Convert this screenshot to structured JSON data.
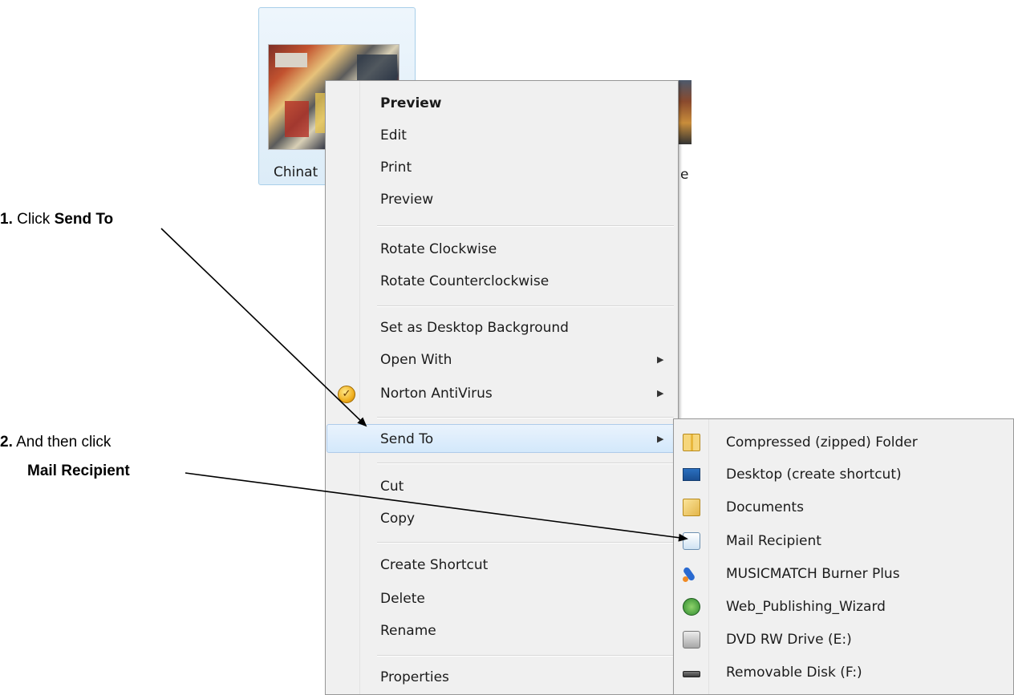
{
  "instructions": {
    "step1": {
      "num": "1.",
      "text": "Click ",
      "bold": "Send To"
    },
    "step2": {
      "num": "2.",
      "text": "And then click",
      "bold": "Mail Recipient"
    }
  },
  "files": [
    {
      "label": "Chinat",
      "icon": "photo-thumbnail-icon"
    },
    {
      "label": "e",
      "icon": "photo-thumbnail-icon"
    }
  ],
  "context_menu": {
    "items": [
      {
        "label": "Preview",
        "bold": true
      },
      {
        "label": "Edit"
      },
      {
        "label": "Print"
      },
      {
        "label": "Preview"
      },
      {
        "label": "Rotate Clockwise"
      },
      {
        "label": "Rotate Counterclockwise"
      },
      {
        "label": "Set as Desktop Background"
      },
      {
        "label": "Open With",
        "submenu": true
      },
      {
        "label": "Norton AntiVirus",
        "submenu": true,
        "icon": "norton-icon"
      },
      {
        "label": "Send To",
        "submenu": true,
        "highlighted": true
      },
      {
        "label": "Cut"
      },
      {
        "label": "Copy"
      },
      {
        "label": "Create Shortcut"
      },
      {
        "label": "Delete"
      },
      {
        "label": "Rename"
      },
      {
        "label": "Properties"
      }
    ],
    "arrow_glyph": "▶"
  },
  "send_to_menu": {
    "items": [
      {
        "label": "Compressed (zipped) Folder",
        "icon": "zip-folder-icon"
      },
      {
        "label": "Desktop (create shortcut)",
        "icon": "desktop-icon"
      },
      {
        "label": "Documents",
        "icon": "documents-folder-icon"
      },
      {
        "label": "Mail Recipient",
        "icon": "mail-icon"
      },
      {
        "label": "MUSICMATCH Burner Plus",
        "icon": "musicmatch-icon"
      },
      {
        "label": "Web_Publishing_Wizard",
        "icon": "web-publishing-icon"
      },
      {
        "label": "DVD RW Drive (E:)",
        "icon": "dvd-drive-icon"
      },
      {
        "label": "Removable Disk (F:)",
        "icon": "removable-disk-icon"
      }
    ]
  },
  "colors": {
    "highlight_fill": "#d3e8fb",
    "highlight_border": "#aecbea",
    "menu_bg": "#f0f0f0",
    "selection_tile": "#dcecf8"
  }
}
